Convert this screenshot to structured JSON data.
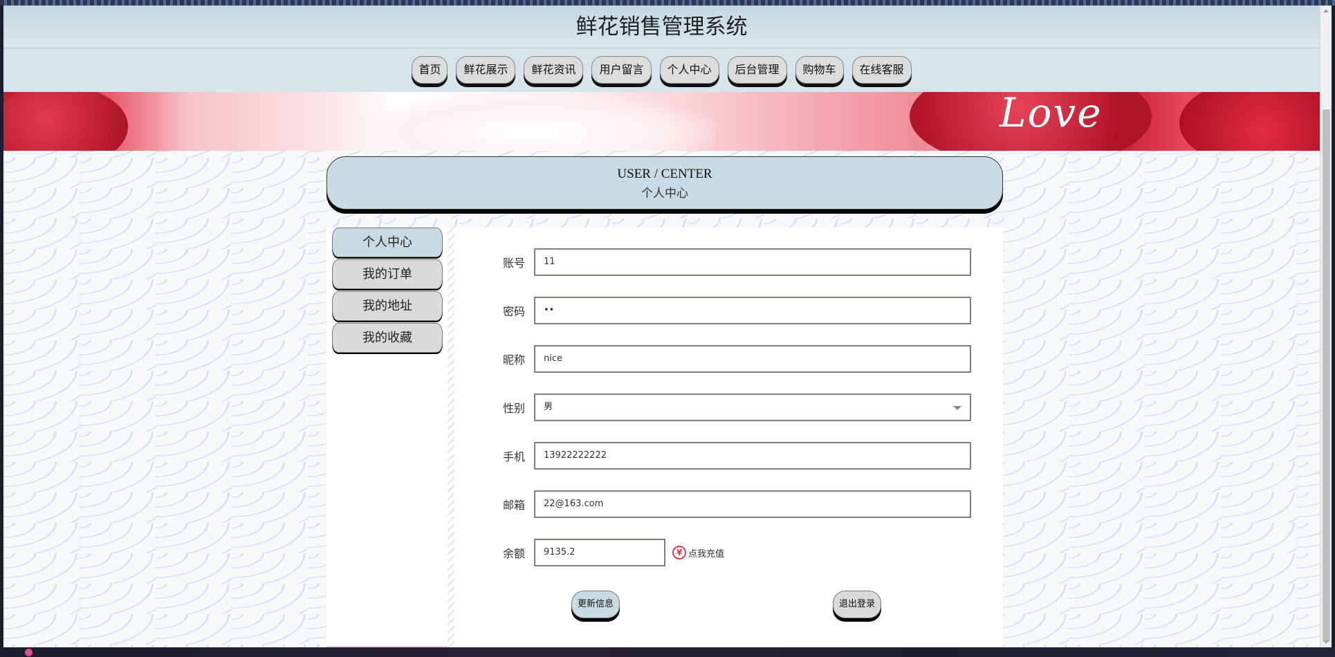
{
  "site": {
    "title": "鲜花销售管理系统"
  },
  "nav": {
    "items": [
      {
        "label": "首页"
      },
      {
        "label": "鲜花展示"
      },
      {
        "label": "鲜花资讯"
      },
      {
        "label": "用户留言"
      },
      {
        "label": "个人中心"
      },
      {
        "label": "后台管理"
      },
      {
        "label": "购物车"
      },
      {
        "label": "在线客服"
      }
    ]
  },
  "banner": {
    "text": "Love"
  },
  "section": {
    "title_en": "USER / CENTER",
    "title_cn": "个人中心"
  },
  "sidebar": {
    "items": [
      {
        "label": "个人中心",
        "active": true
      },
      {
        "label": "我的订单",
        "active": false
      },
      {
        "label": "我的地址",
        "active": false
      },
      {
        "label": "我的收藏",
        "active": false
      }
    ]
  },
  "form": {
    "account": {
      "label": "账号",
      "value": "11"
    },
    "password": {
      "label": "密码",
      "value": "••"
    },
    "nickname": {
      "label": "昵称",
      "value": "nice"
    },
    "gender": {
      "label": "性别",
      "value": "男"
    },
    "phone": {
      "label": "手机",
      "value": "13922222222"
    },
    "email": {
      "label": "邮箱",
      "value": "22@163.com"
    },
    "balance": {
      "label": "余额",
      "value": "9135.2"
    },
    "recharge": {
      "icon_text": "¥",
      "label": "点我充值"
    }
  },
  "actions": {
    "update_label": "更新信息",
    "logout_label": "退出登录"
  },
  "colors": {
    "header_bg": "#c5d7df",
    "accent": "#c9dbe2",
    "recharge_red": "#e43c4c"
  }
}
